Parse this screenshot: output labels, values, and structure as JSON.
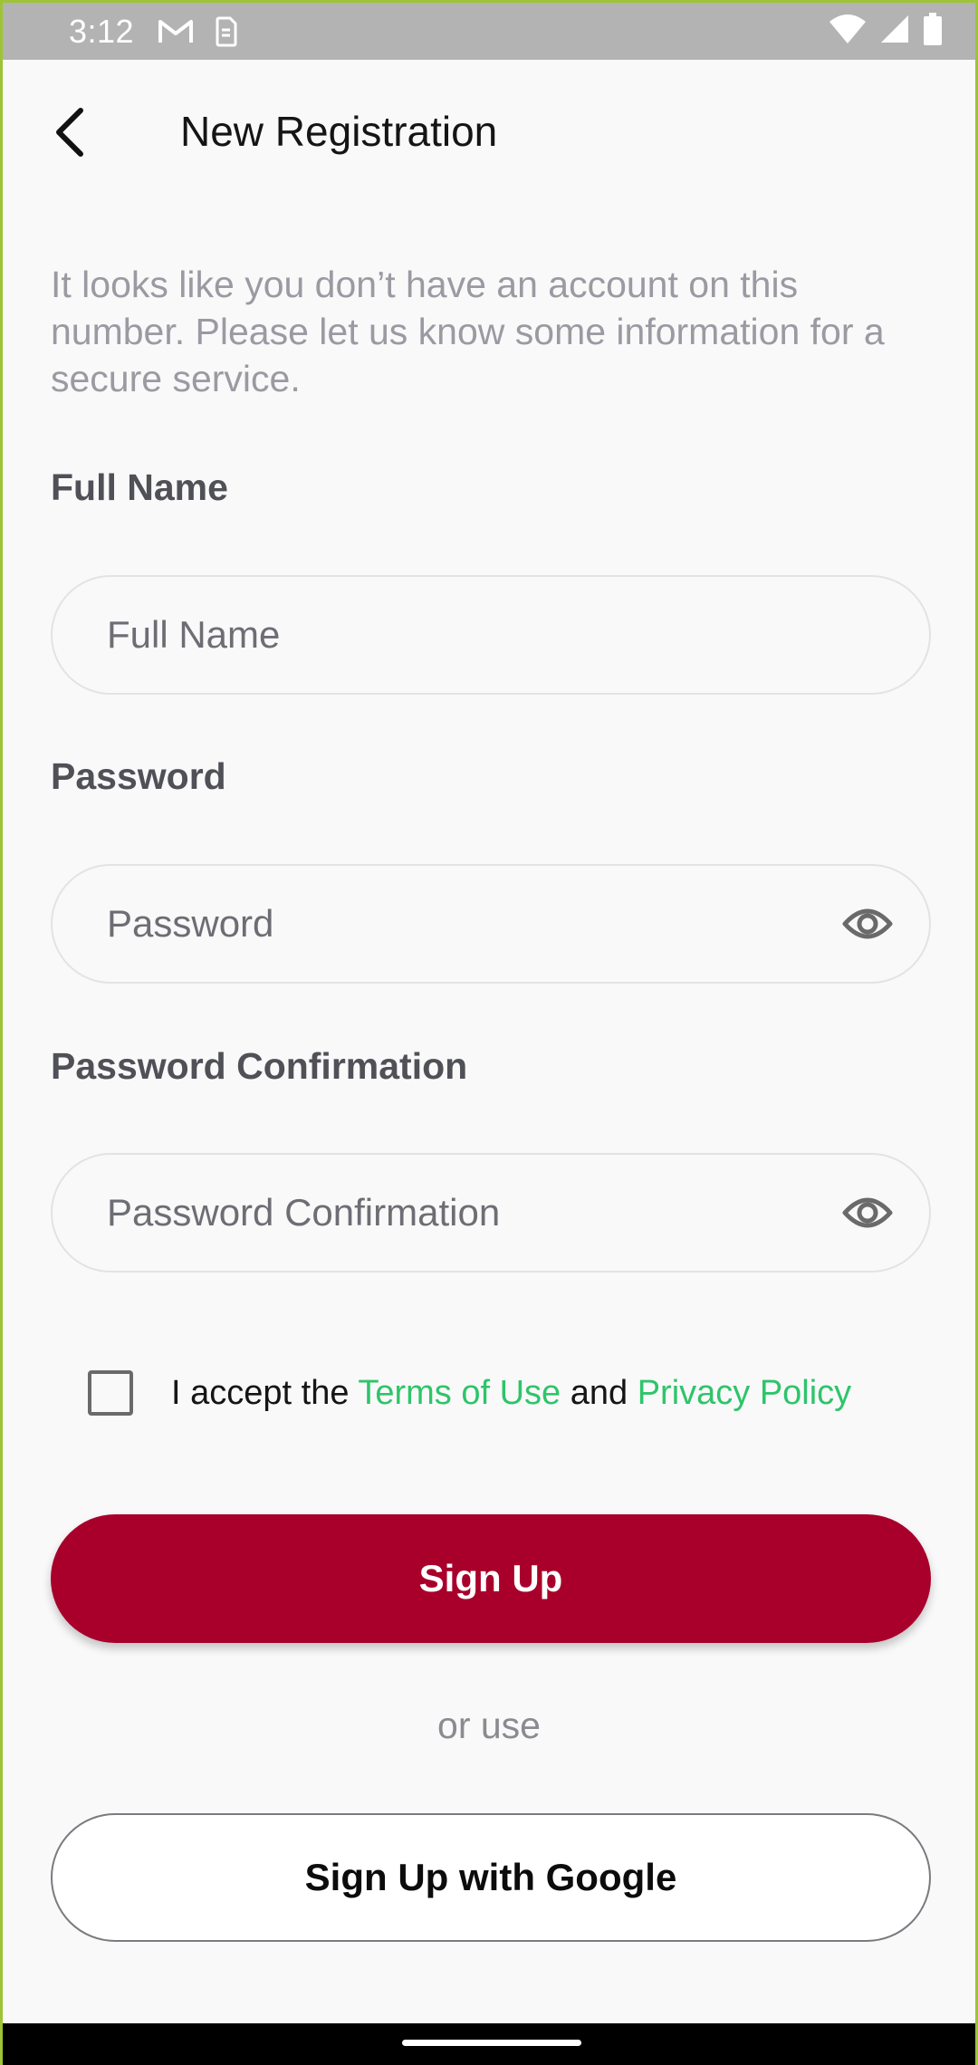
{
  "status_bar": {
    "time": "3:12",
    "icons": [
      "gmail-icon",
      "sim-card-icon",
      "wifi-icon",
      "signal-icon",
      "battery-icon"
    ]
  },
  "header": {
    "back_icon": "arrow-back-icon",
    "title": "New Registration"
  },
  "intro_text": "It looks like you don’t have an account on this number. Please let us know some information for a secure service.",
  "form": {
    "full_name": {
      "label": "Full Name",
      "placeholder": "Full Name",
      "value": ""
    },
    "password": {
      "label": "Password",
      "placeholder": "Password",
      "value": "",
      "toggle_icon": "eye-icon"
    },
    "password_confirmation": {
      "label": "Password Confirmation",
      "placeholder": "Password Confirmation",
      "value": "",
      "toggle_icon": "eye-icon"
    }
  },
  "terms": {
    "checked": false,
    "prefix": "I accept the ",
    "terms_link": "Terms of Use",
    "middle": " and ",
    "privacy_link": "Privacy Policy"
  },
  "buttons": {
    "sign_up": "Sign Up",
    "or_use": "or use",
    "google": "Sign Up with Google"
  },
  "colors": {
    "primary": "#a8002a",
    "link": "#2fc46a",
    "background": "#f9f9fa",
    "status_bar": "#b3b3b3"
  }
}
